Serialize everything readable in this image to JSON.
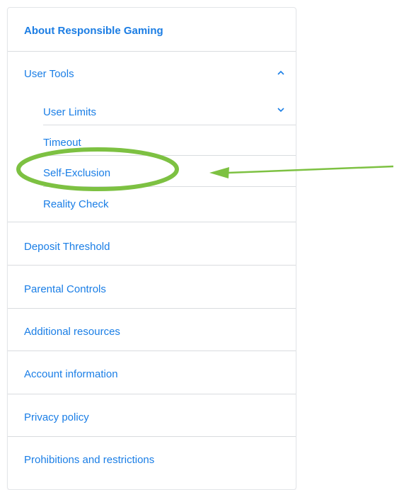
{
  "nav": {
    "title": "About Responsible Gaming",
    "user_tools": {
      "label": "User Tools",
      "expanded": true,
      "items": [
        {
          "label": "User Limits"
        },
        {
          "label": "Timeout"
        },
        {
          "label": "Self-Exclusion"
        },
        {
          "label": "Reality Check"
        }
      ]
    },
    "items": [
      {
        "label": "Deposit Threshold"
      },
      {
        "label": "Parental Controls"
      },
      {
        "label": "Additional resources"
      },
      {
        "label": "Account information"
      },
      {
        "label": "Privacy policy"
      },
      {
        "label": "Prohibitions and restrictions"
      }
    ]
  },
  "colors": {
    "link": "#1a7ee6",
    "divider": "#d9dcdf",
    "annotation": "#7dc142"
  },
  "icons": {
    "user_tools_toggle": "chevron-up-icon",
    "user_limits_toggle": "chevron-down-icon"
  }
}
